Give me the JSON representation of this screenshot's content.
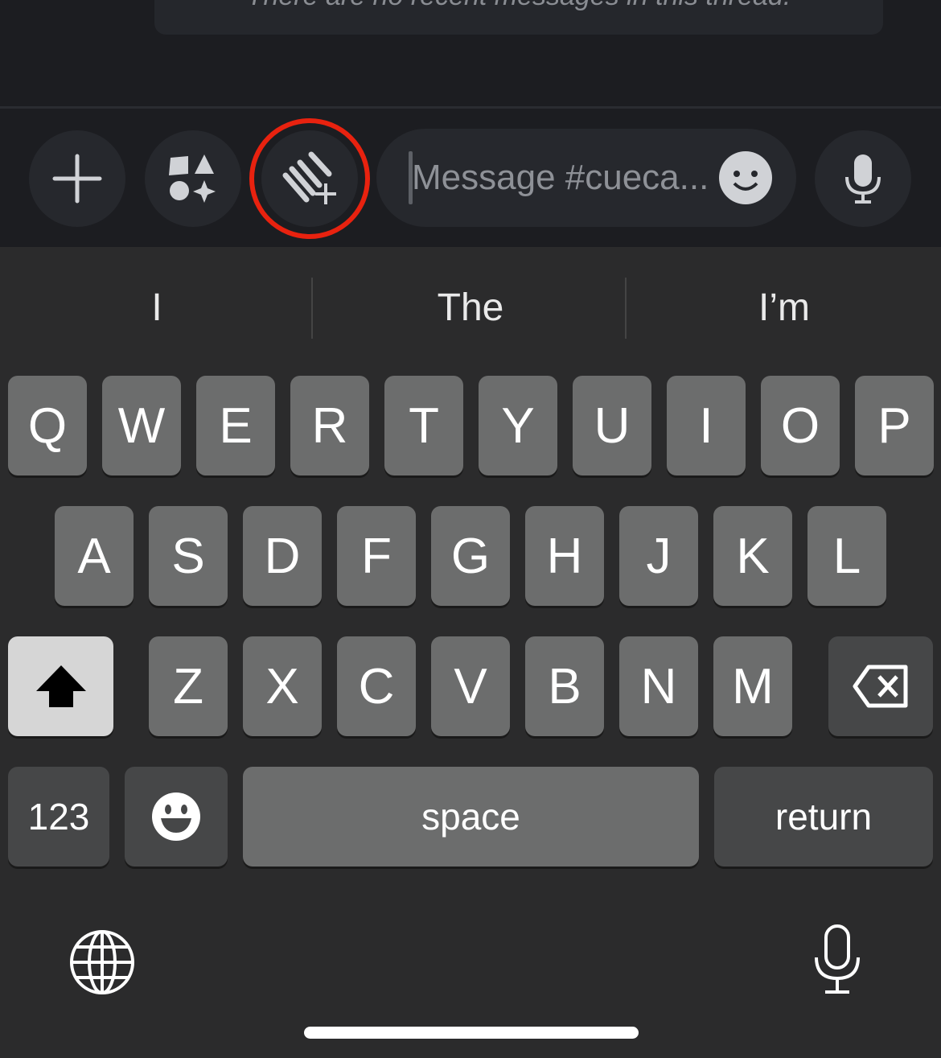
{
  "chat": {
    "empty_message": "There are no recent messages in this thread."
  },
  "composer": {
    "placeholder": "Message #cueca...",
    "highlight_color": "#e8220f"
  },
  "suggestions": [
    "I",
    "The",
    "I’m"
  ],
  "keyboard": {
    "rows": [
      [
        "Q",
        "W",
        "E",
        "R",
        "T",
        "Y",
        "U",
        "I",
        "O",
        "P"
      ],
      [
        "A",
        "S",
        "D",
        "F",
        "G",
        "H",
        "J",
        "K",
        "L"
      ],
      [
        "Z",
        "X",
        "C",
        "V",
        "B",
        "N",
        "M"
      ]
    ],
    "numbers_label": "123",
    "space_label": "space",
    "return_label": "return"
  }
}
